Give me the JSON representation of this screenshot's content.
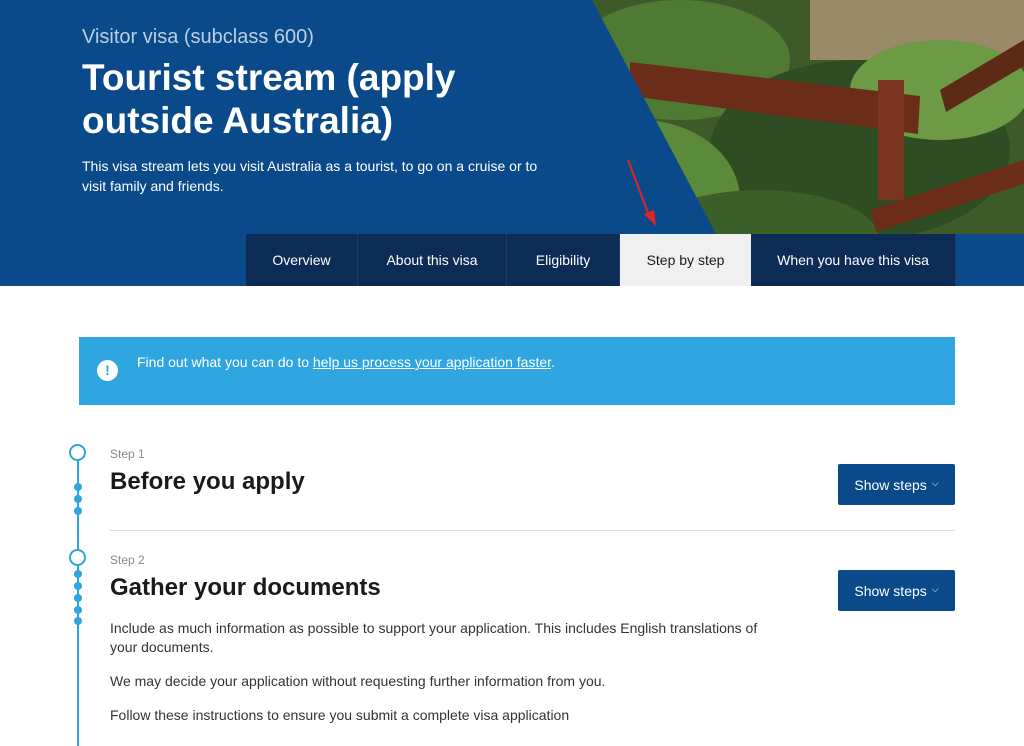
{
  "hero": {
    "eyebrow": "Visitor visa (subclass 600)",
    "title": "Tourist stream (apply outside Australia)",
    "description": "This visa stream lets you visit Australia as a tourist, to go on a cruise or to visit family and friends."
  },
  "tabs": [
    {
      "label": "Overview",
      "active": false
    },
    {
      "label": "About this visa",
      "active": false
    },
    {
      "label": "Eligibility",
      "active": false
    },
    {
      "label": "Step by step",
      "active": true
    },
    {
      "label": "When you have this visa",
      "active": false
    }
  ],
  "banner": {
    "icon": "exclamation-icon",
    "prefix": "Find out what you can do to ",
    "link": "help us process your application faster",
    "suffix": "."
  },
  "steps": [
    {
      "label": "Step 1",
      "title": "Before you apply",
      "button": "Show steps"
    },
    {
      "label": "Step 2",
      "title": "Gather your documents",
      "button": "Show steps",
      "paragraphs": [
        "Include as much information as possible to support your application. This includes English translations of your documents.",
        "We may decide your application without requesting further information from you.",
        "Follow these instructions to ensure you submit a complete visa application"
      ]
    }
  ],
  "colors": {
    "hero_blue": "#0b4a8a",
    "tab_bar": "#0c2c55",
    "banner": "#2fa6e0",
    "button": "#0b4a8a"
  }
}
